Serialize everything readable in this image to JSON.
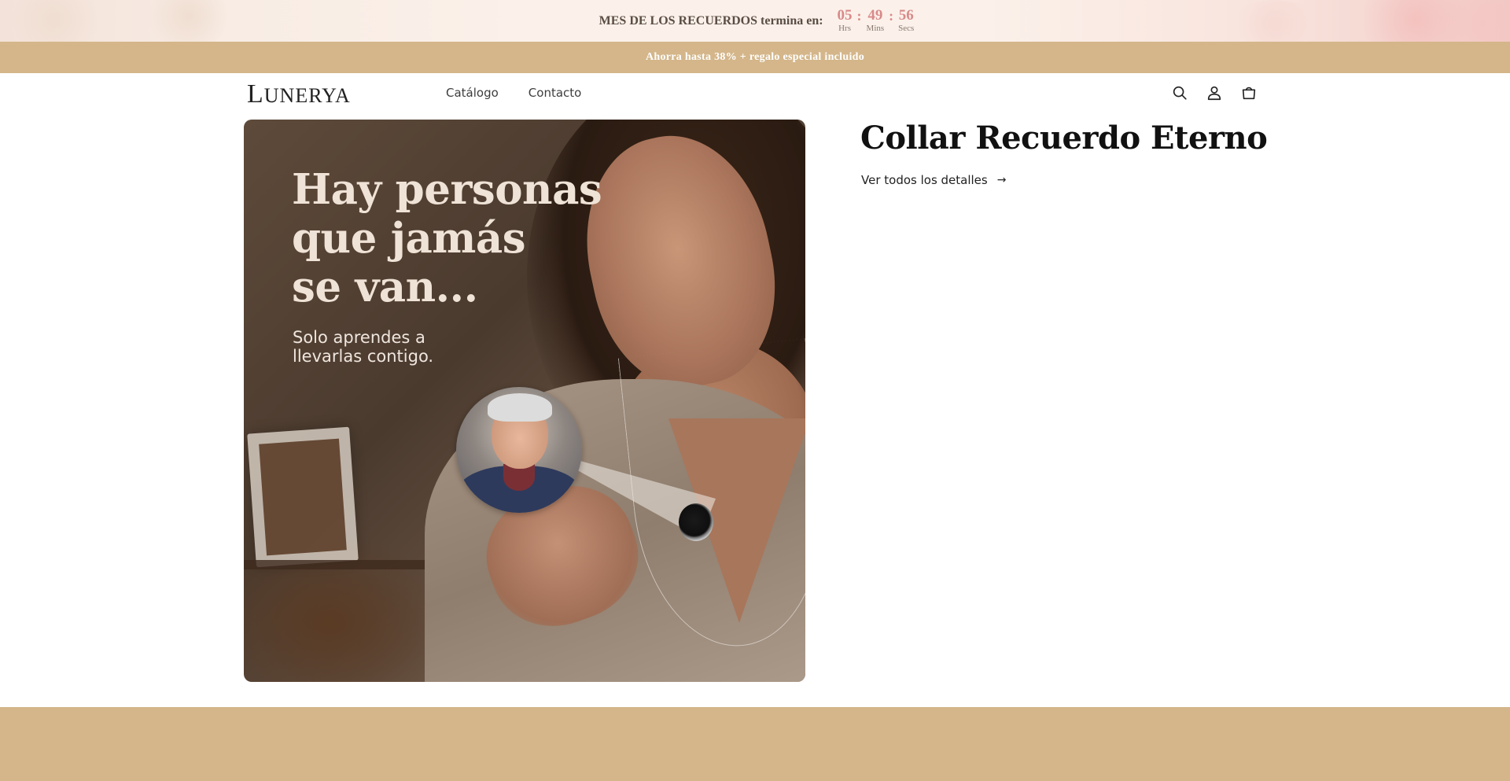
{
  "countdown": {
    "message": "MES DE LOS RECUERDOS termina en:",
    "emoji": "",
    "hours": "05",
    "minutes": "49",
    "seconds": "56",
    "hours_label": "Hrs",
    "minutes_label": "Mins",
    "seconds_label": "Secs",
    "separator": ":"
  },
  "promo": {
    "text": "Ahorra hasta 38% + regalo especial incluido"
  },
  "header": {
    "logo_initial": "L",
    "logo_rest": "UNERYA",
    "nav": [
      {
        "label": "Catálogo"
      },
      {
        "label": "Contacto"
      }
    ],
    "icons": [
      "search-icon",
      "account-icon",
      "cart-icon"
    ]
  },
  "hero": {
    "headline_line1": "Hay personas",
    "headline_line2": "que jamás",
    "headline_line3": "se van...",
    "sub_line1": "Solo aprendes a",
    "sub_line2": "llevarlas contigo."
  },
  "product": {
    "title": "Collar Recuerdo Eterno",
    "details_link": "Ver todos los detalles",
    "details_arrow": "→"
  },
  "colors": {
    "promo_bg": "#d4b68a",
    "timer_accent": "#d98a8a",
    "text_dark": "#111111"
  }
}
